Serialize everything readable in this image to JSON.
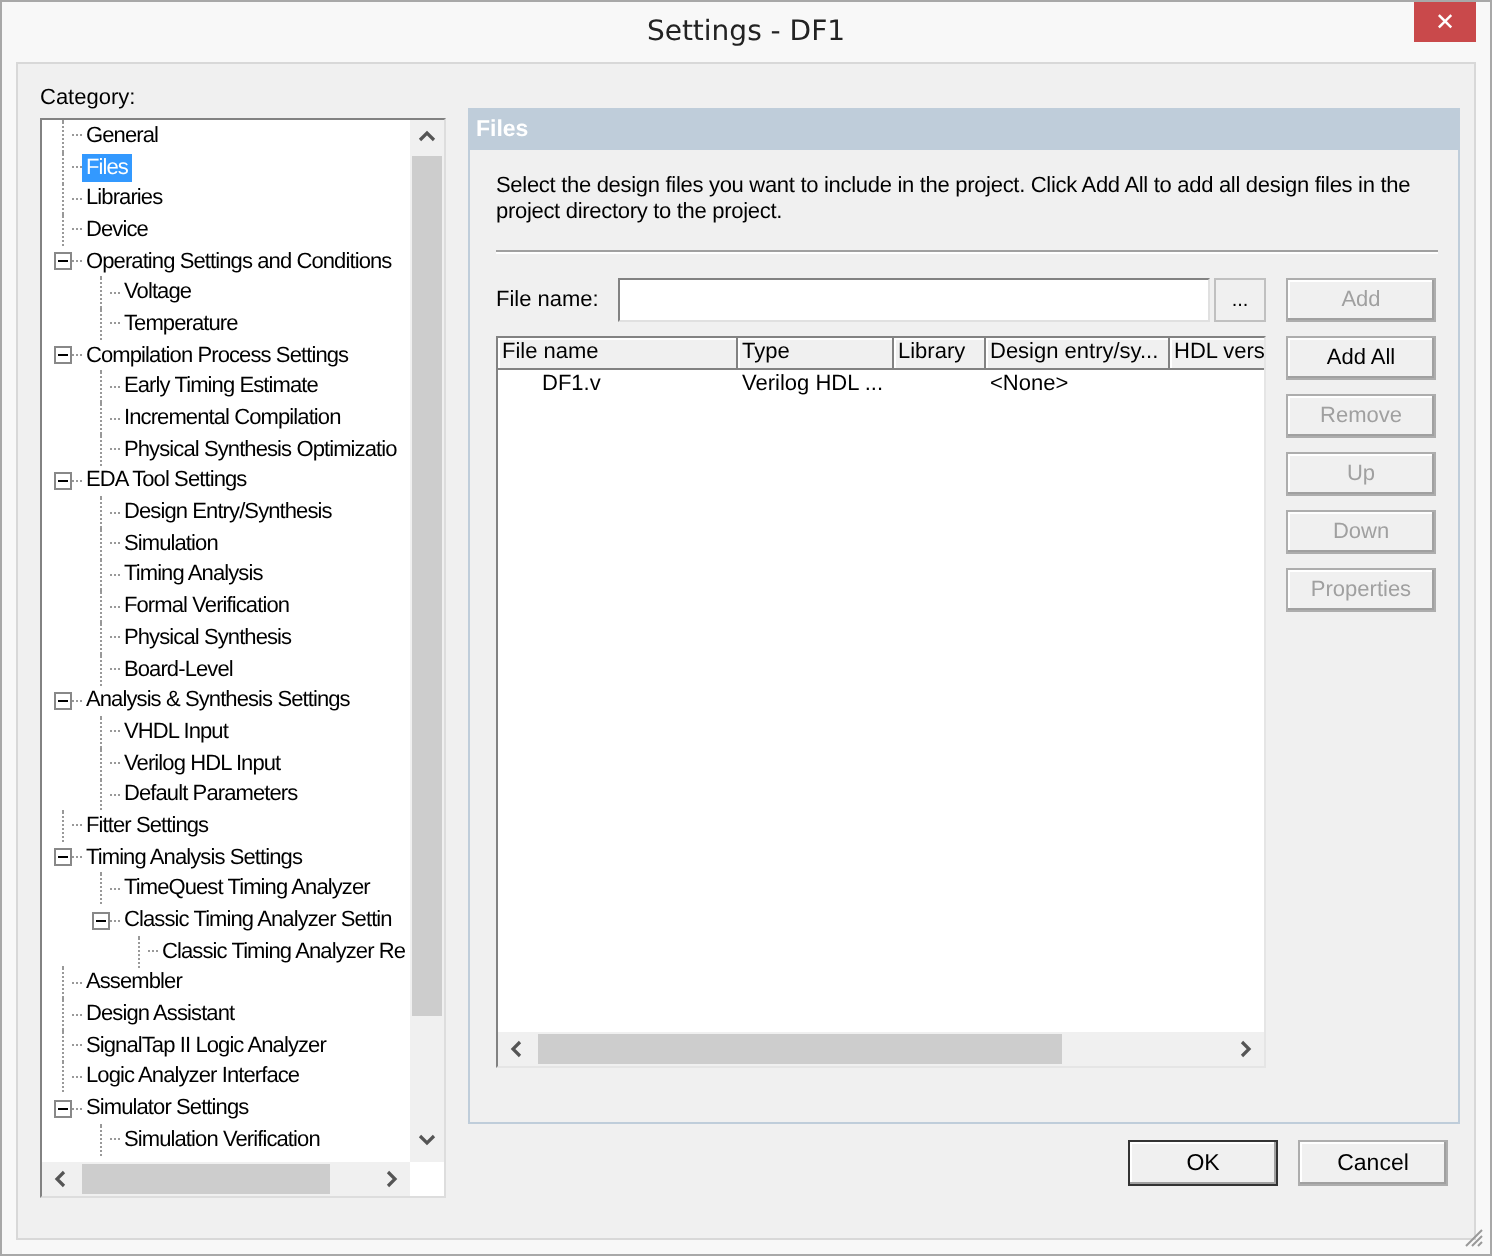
{
  "window": {
    "title": "Settings - DF1",
    "close": "✕"
  },
  "category_label": "Category:",
  "tree": [
    {
      "label": "General",
      "selected": false
    },
    {
      "label": "Files",
      "selected": true
    },
    {
      "label": "Libraries",
      "selected": false
    },
    {
      "label": "Device",
      "selected": false
    },
    {
      "label": "Operating Settings and Conditions",
      "selected": false,
      "expanded": true,
      "children": [
        {
          "label": "Voltage",
          "selected": false
        },
        {
          "label": "Temperature",
          "selected": false
        }
      ]
    },
    {
      "label": "Compilation Process Settings",
      "selected": false,
      "expanded": true,
      "children": [
        {
          "label": "Early Timing Estimate",
          "selected": false
        },
        {
          "label": "Incremental Compilation",
          "selected": false
        },
        {
          "label": "Physical Synthesis Optimizatio",
          "selected": false
        }
      ]
    },
    {
      "label": "EDA Tool Settings",
      "selected": false,
      "expanded": true,
      "children": [
        {
          "label": "Design Entry/Synthesis",
          "selected": false
        },
        {
          "label": "Simulation",
          "selected": false
        },
        {
          "label": "Timing Analysis",
          "selected": false
        },
        {
          "label": "Formal Verification",
          "selected": false
        },
        {
          "label": "Physical Synthesis",
          "selected": false
        },
        {
          "label": "Board-Level",
          "selected": false
        }
      ]
    },
    {
      "label": "Analysis & Synthesis Settings",
      "selected": false,
      "expanded": true,
      "children": [
        {
          "label": "VHDL Input",
          "selected": false
        },
        {
          "label": "Verilog HDL Input",
          "selected": false
        },
        {
          "label": "Default Parameters",
          "selected": false
        }
      ]
    },
    {
      "label": "Fitter Settings",
      "selected": false
    },
    {
      "label": "Timing Analysis Settings",
      "selected": false,
      "expanded": true,
      "children": [
        {
          "label": "TimeQuest Timing Analyzer",
          "selected": false
        },
        {
          "label": "Classic Timing Analyzer Settin",
          "selected": false,
          "expanded": true,
          "children": [
            {
              "label": "Classic Timing Analyzer Re",
              "selected": false
            }
          ]
        }
      ]
    },
    {
      "label": "Assembler",
      "selected": false
    },
    {
      "label": "Design Assistant",
      "selected": false
    },
    {
      "label": "SignalTap II Logic Analyzer",
      "selected": false
    },
    {
      "label": "Logic Analyzer Interface",
      "selected": false
    },
    {
      "label": "Simulator Settings",
      "selected": false,
      "expanded": true,
      "children": [
        {
          "label": "Simulation Verification",
          "selected": false
        }
      ]
    }
  ],
  "panel": {
    "title": "Files",
    "description": "Select the design files you want to include in the project. Click Add All to add all design files in the project directory to the project.",
    "file_name": {
      "label": "File name:",
      "browse": "..."
    },
    "table": {
      "columns": [
        "File name",
        "Type",
        "Library",
        "Design entry/sy...",
        "HDL vers"
      ],
      "rows": [
        [
          "DF1.v",
          "Verilog HDL ...",
          null,
          "<None>",
          null
        ]
      ]
    },
    "buttons": [
      {
        "label": "Add",
        "disabled": true
      },
      {
        "label": "Add All",
        "disabled": false
      },
      {
        "label": "Remove",
        "disabled": true
      },
      {
        "label": "Up",
        "disabled": true
      },
      {
        "label": "Down",
        "disabled": true
      },
      {
        "label": "Properties",
        "disabled": true
      }
    ]
  },
  "footer_buttons": [
    {
      "label": "OK",
      "default": true
    },
    {
      "label": "Cancel",
      "default": false
    }
  ]
}
